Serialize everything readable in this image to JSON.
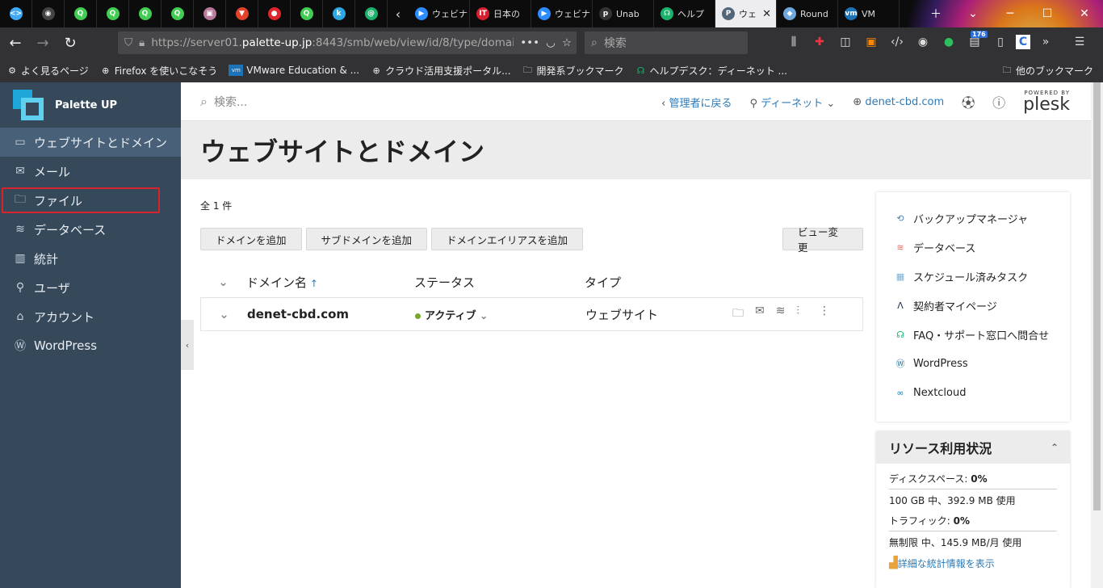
{
  "browser": {
    "tabs": [
      {
        "label": "",
        "icon": "code-icon",
        "color": "#3fa9f5"
      },
      {
        "label": "",
        "icon": "github-icon",
        "color": "#444"
      },
      {
        "label": "",
        "icon": "qt-icon",
        "color": "#41cd52"
      },
      {
        "label": "",
        "icon": "qt-icon",
        "color": "#41cd52"
      },
      {
        "label": "",
        "icon": "qt-icon",
        "color": "#41cd52"
      },
      {
        "label": "",
        "icon": "qt-icon",
        "color": "#41cd52"
      },
      {
        "label": "",
        "icon": "image-icon",
        "color": "#b87a9a"
      },
      {
        "label": "",
        "icon": "gitlab-icon",
        "color": "#e2432a"
      },
      {
        "label": "",
        "icon": "red-circle-icon",
        "color": "#e0262c"
      },
      {
        "label": "",
        "icon": "qt-icon",
        "color": "#41cd52"
      },
      {
        "label": "",
        "icon": "k-icon",
        "color": "#2ea8e0"
      },
      {
        "label": "",
        "icon": "at-icon",
        "color": "#1ab26b"
      }
    ],
    "wide_tabs": [
      {
        "label": "ウェビナ",
        "icon": "zoom-icon",
        "color": "#2d8cff"
      },
      {
        "label": "日本の",
        "icon": "it-icon",
        "color": "#d6202e"
      },
      {
        "label": "ウェビナ",
        "icon": "zoom-icon",
        "color": "#2d8cff"
      },
      {
        "label": "Unab",
        "icon": "plesk-icon",
        "color": "#333"
      },
      {
        "label": "ヘルプ",
        "icon": "help-icon",
        "color": "#1ab26b"
      },
      {
        "label": "ウェ",
        "icon": "p-icon",
        "color": "#52667a",
        "active": true,
        "close": "✕"
      },
      {
        "label": "Round",
        "icon": "diamond-icon",
        "color": "#6fa8dc"
      },
      {
        "label": "VM",
        "icon": "vmware-icon",
        "color": "#1d73b7"
      }
    ],
    "url": {
      "prefix": "https://server01.",
      "host": "palette-up.jp",
      "suffix": ":8443/smb/web/view/id/8/type/domain"
    },
    "search_placeholder": "検索",
    "badge": "176",
    "bookmarks": [
      {
        "label": "よく見るページ",
        "icon": "gear-icon"
      },
      {
        "label": "Firefox を使いこなそう",
        "icon": "globe-icon"
      },
      {
        "label": "VMware Education & ...",
        "icon": "vmware-icon"
      },
      {
        "label": "クラウド活用支援ポータル...",
        "icon": "globe-icon"
      },
      {
        "label": "開発系ブックマーク",
        "icon": "folder-icon"
      },
      {
        "label": "ヘルプデスク：ディーネット ...",
        "icon": "help-icon"
      }
    ],
    "other_bookmarks": "他のブックマーク"
  },
  "sidebar": {
    "brand": "Palette UP",
    "items": [
      {
        "label": "ウェブサイトとドメイン",
        "icon": "monitor-icon",
        "active": true
      },
      {
        "label": "メール",
        "icon": "mail-icon"
      },
      {
        "label": "ファイル",
        "icon": "folder-icon",
        "highlighted": true
      },
      {
        "label": "データベース",
        "icon": "database-icon"
      },
      {
        "label": "統計",
        "icon": "chart-icon"
      },
      {
        "label": "ユーザ",
        "icon": "user-icon"
      },
      {
        "label": "アカウント",
        "icon": "account-icon"
      },
      {
        "label": "WordPress",
        "icon": "wordpress-icon"
      }
    ]
  },
  "topbar": {
    "search_placeholder": "検索...",
    "back_admin": "管理者に戻る",
    "user": "ディーネット",
    "domain": "denet-cbd.com",
    "powered": "POWERED BY",
    "plesk": "plesk"
  },
  "page": {
    "title": "ウェブサイトとドメイン",
    "count": "全 1 件",
    "buttons": [
      "ドメインを追加",
      "サブドメインを追加",
      "ドメインエイリアスを追加"
    ],
    "view_button": "ビュー変更",
    "columns": {
      "name": "ドメイン名",
      "status": "ステータス",
      "type": "タイプ"
    },
    "rows": [
      {
        "name": "denet-cbd.com",
        "status": "アクティブ",
        "type": "ウェブサイト"
      }
    ]
  },
  "tools": [
    {
      "label": "バックアップマネージャ",
      "icon": "backup-icon"
    },
    {
      "label": "データベース",
      "icon": "database-icon"
    },
    {
      "label": "スケジュール済みタスク",
      "icon": "calendar-icon"
    },
    {
      "label": "契約者マイページ",
      "icon": "a-logo-icon"
    },
    {
      "label": "FAQ・サポート窓口へ問合せ",
      "icon": "help-icon"
    },
    {
      "label": "WordPress",
      "icon": "wordpress-icon"
    },
    {
      "label": "Nextcloud",
      "icon": "nextcloud-icon"
    }
  ],
  "resources": {
    "title": "リソース利用状況",
    "disk_label": "ディスクスペース:",
    "disk_value": "0%",
    "disk_detail": "100 GB 中、392.9 MB 使用",
    "traffic_label": "トラフィック:",
    "traffic_value": "0%",
    "traffic_detail": "無制限 中、145.9 MB/月 使用",
    "link": "詳細な統計情報を表示"
  }
}
